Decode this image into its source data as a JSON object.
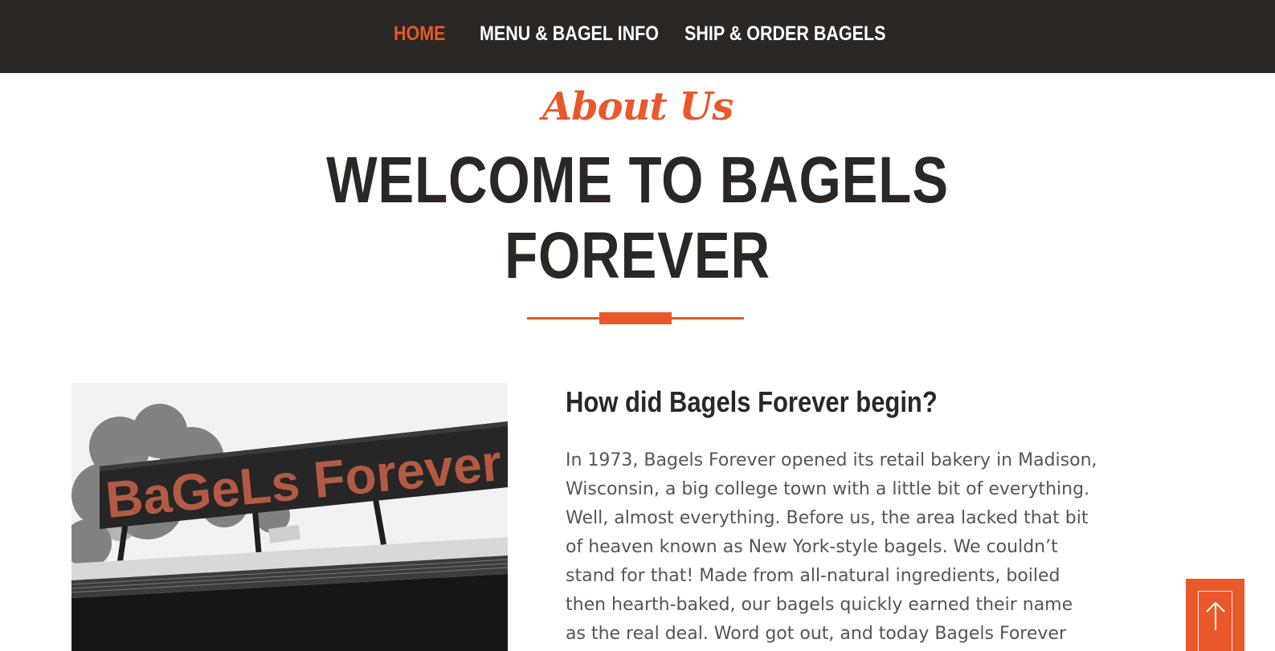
{
  "nav": {
    "items": [
      {
        "label": "HOME",
        "active": true
      },
      {
        "label": "MENU & BAGEL INFO",
        "active": false
      },
      {
        "label": "SHIP & ORDER BAGELS",
        "active": false
      }
    ]
  },
  "hero": {
    "eyebrow": "About Us",
    "title_line1": "WELCOME TO BAGELS",
    "title_line2": "FOREVER"
  },
  "photo": {
    "sign_text": "BaGeLs Forever"
  },
  "story": {
    "heading": "How did Bagels Forever begin?",
    "lines": [
      "In 1973, Bagels Forever opened its retail bakery in Madison,",
      "Wisconsin, a big college town with a little bit of everything.",
      "Well, almost everything. Before us, the area lacked that bit",
      "of heaven known as New York-style bagels. We couldn’t",
      "stand for that! Made from all-natural ingredients, boiled",
      "then hearth-baked, our bagels quickly earned their name",
      "as the real deal. Word got out, and today Bagels Forever"
    ]
  },
  "scroll_top": {
    "icon": "arrow-up-icon"
  },
  "colors": {
    "accent": "#e8582a",
    "nav_bg": "#2b2725",
    "heading": "#2b2725",
    "body_text": "#5a5350"
  }
}
